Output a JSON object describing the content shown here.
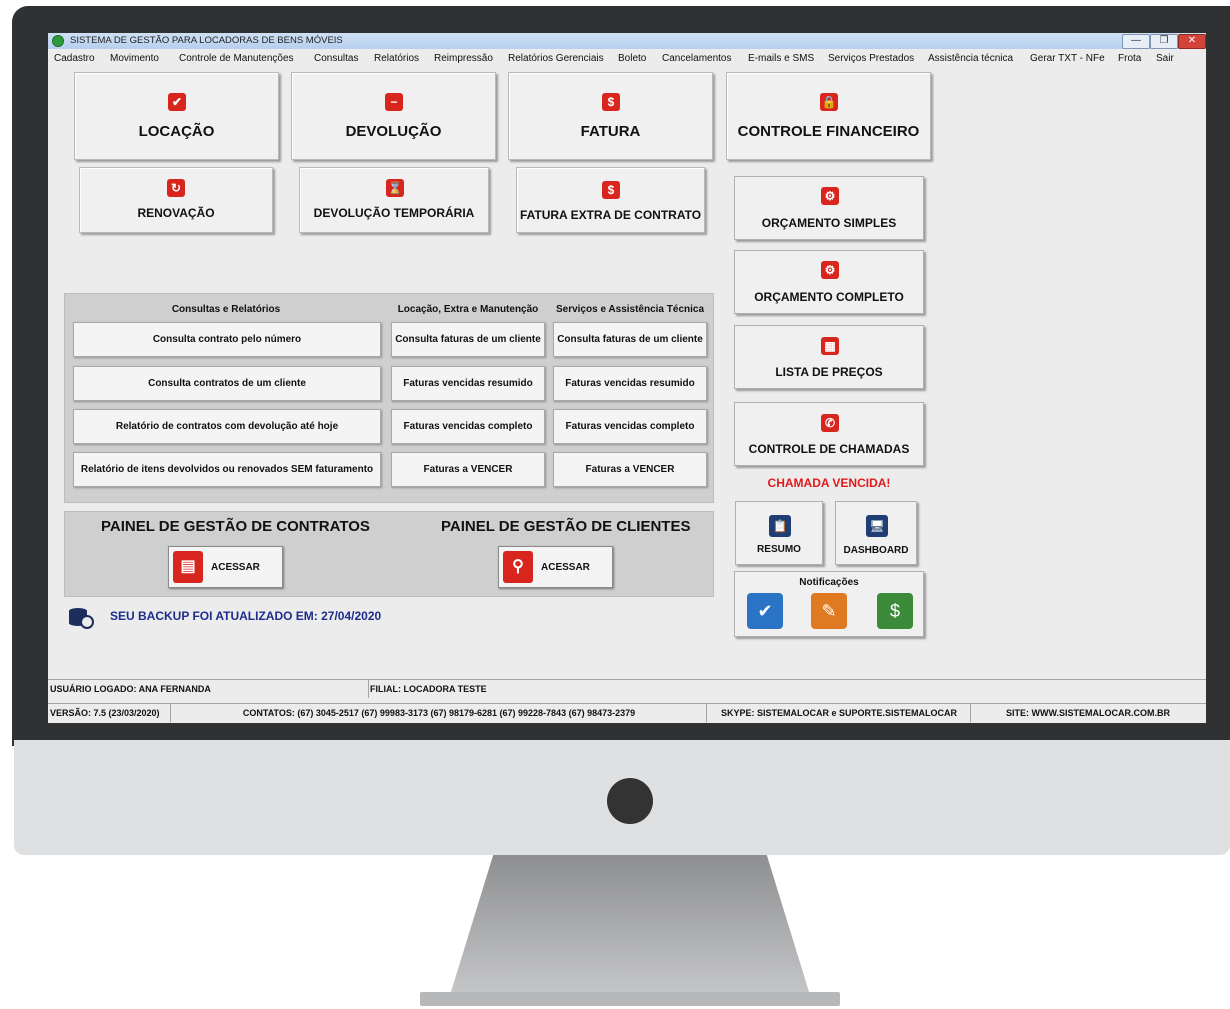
{
  "window": {
    "title": "SISTEMA DE GESTÃO PARA LOCADORAS DE BENS MÓVEIS",
    "min_glyph": "—",
    "max_glyph": "❐",
    "close_glyph": "✕"
  },
  "menu": [
    "Cadastro",
    "Movimento",
    "Controle de Manutenções",
    "Consultas",
    "Relatórios",
    "Reimpressão",
    "Relatórios Gerenciais",
    "Boleto",
    "Cancelamentos",
    "E-mails e SMS",
    "Serviços Prestados",
    "Assistência técnica",
    "Gerar TXT - NFe",
    "Frota",
    "Sair"
  ],
  "main_buttons": {
    "locacao": {
      "label": "LOCAÇÃO",
      "icon": "checkbox-icon",
      "glyph": "✔"
    },
    "devolucao": {
      "label": "DEVOLUÇÃO",
      "icon": "minus-icon",
      "glyph": "−"
    },
    "fatura": {
      "label": "FATURA",
      "icon": "dollar-icon",
      "glyph": "$"
    },
    "controle_financeiro": {
      "label": "CONTROLE FINANCEIRO",
      "icon": "lock-icon",
      "glyph": "🔒"
    },
    "renovacao": {
      "label": "RENOVAÇÃO",
      "icon": "renew-icon",
      "glyph": "↻"
    },
    "devolucao_temporaria": {
      "label": "DEVOLUÇÃO TEMPORÁRIA",
      "icon": "hourglass-icon",
      "glyph": "⌛"
    },
    "fatura_extra": {
      "label": "FATURA EXTRA DE CONTRATO",
      "icon": "dollar-icon",
      "glyph": "$"
    }
  },
  "right_buttons": {
    "orcamento_simples": {
      "label": "ORÇAMENTO SIMPLES",
      "icon": "gear-icon",
      "glyph": "⚙"
    },
    "orcamento_completo": {
      "label": "ORÇAMENTO COMPLETO",
      "icon": "gear-icon",
      "glyph": "⚙"
    },
    "lista_precos": {
      "label": "LISTA DE PREÇOS",
      "icon": "calculator-icon",
      "glyph": "▦"
    },
    "controle_chamadas": {
      "label": "CONTROLE DE CHAMADAS",
      "icon": "phone-icon",
      "glyph": "✆"
    }
  },
  "alert": "CHAMADA VENCIDA!",
  "tiles": {
    "resumo": {
      "label": "RESUMO",
      "icon": "clipboard-icon",
      "glyph": "📋"
    },
    "dashboard": {
      "label": "DASHBOARD",
      "icon": "monitor-icon",
      "glyph": "🖥"
    }
  },
  "notifications": {
    "title": "Notificações",
    "items": [
      {
        "icon": "document-check-icon",
        "color": "#2b73c4",
        "glyph": "✔"
      },
      {
        "icon": "document-edit-icon",
        "color": "#e07a22",
        "glyph": "✎"
      },
      {
        "icon": "document-money-icon",
        "color": "#3b8b3a",
        "glyph": "$"
      }
    ]
  },
  "reports": {
    "headers": [
      "Consultas e Relatórios",
      "Locação, Extra e Manutenção",
      "Serviços e Assistência Técnica"
    ],
    "col1": [
      "Consulta contrato pelo número",
      "Consulta contratos de um cliente",
      "Relatório de contratos com devolução até hoje",
      "Relatório de itens devolvidos ou renovados SEM faturamento"
    ],
    "col2": [
      "Consulta faturas de um cliente",
      "Faturas vencidas resumido",
      "Faturas vencidas completo",
      "Faturas a VENCER"
    ],
    "col3": [
      "Consulta faturas de um cliente",
      "Faturas vencidas resumido",
      "Faturas vencidas completo",
      "Faturas a VENCER"
    ]
  },
  "panels": {
    "contratos": {
      "title": "PAINEL DE GESTÃO DE CONTRATOS",
      "button": "ACESSAR"
    },
    "clientes": {
      "title": "PAINEL DE GESTÃO DE CLIENTES",
      "button": "ACESSAR"
    }
  },
  "backup": "SEU BACKUP FOI ATUALIZADO EM: 27/04/2020",
  "status": {
    "user": "USUÁRIO LOGADO: ANA FERNANDA",
    "filial": "FILIAL: LOCADORA TESTE",
    "version": "VERSÃO: 7.5 (23/03/2020)",
    "contacts": "CONTATOS: (67) 3045-2517  (67) 99983-3173  (67) 98179-6281  (67) 99228-7843  (67) 98473-2379",
    "skype": "SKYPE: SISTEMALOCAR e SUPORTE.SISTEMALOCAR",
    "site": "SITE: WWW.SISTEMALOCAR.COM.BR"
  }
}
